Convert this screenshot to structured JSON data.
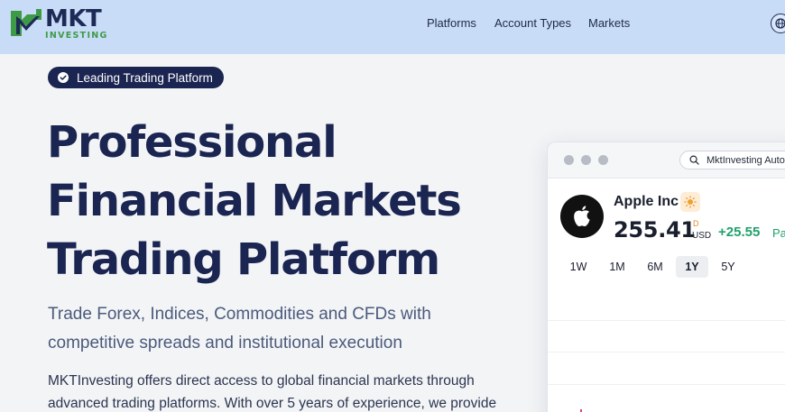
{
  "header": {
    "logo_title": "MKT",
    "logo_sub": "INVESTING",
    "nav": [
      "Platforms",
      "Account Types",
      "Markets"
    ]
  },
  "hero": {
    "badge": "Leading Trading Platform",
    "title_lines": [
      "Professional",
      "Financial Markets",
      "Trading Platform"
    ],
    "subtitle_lines": [
      "Trade Forex, Indices, Commodities and CFDs with",
      "competitive spreads and institutional execution"
    ],
    "paragraph_lines": [
      "MKTInvesting offers direct access to global financial markets through",
      "advanced trading platforms. With over 5 years of experience, we provide"
    ]
  },
  "widget": {
    "search_text": "MktInvesting Auto",
    "stock_name": "Apple Inc",
    "price": "255.41",
    "price_flag": "D",
    "currency": "USD",
    "change": "+25.55",
    "change_extra": "Pa",
    "ranges": [
      "1W",
      "1M",
      "6M",
      "1Y",
      "5Y"
    ],
    "selected_range": "1Y"
  },
  "colors": {
    "header_bg": "#c9dcf7",
    "brand_navy": "#1b2551",
    "brand_green": "#3d9b47",
    "positive": "#22a16b"
  },
  "icons": [
    "logo-mark-icon",
    "globe-icon",
    "check-icon",
    "search-icon",
    "apple-icon",
    "sun-icon"
  ]
}
